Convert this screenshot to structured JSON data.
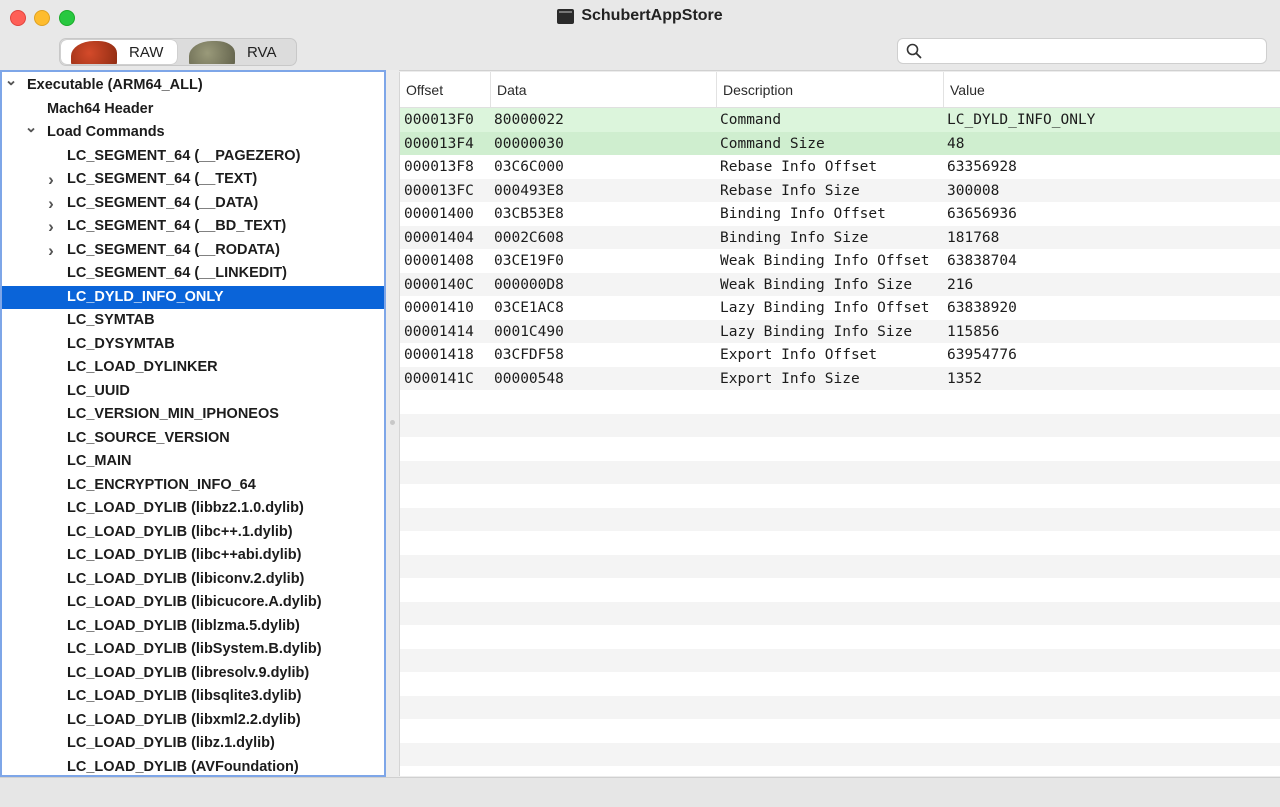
{
  "window": {
    "title": "SchubertAppStore"
  },
  "toolbar": {
    "segments": [
      {
        "label": "RAW",
        "selected": true,
        "icon": "ladybug-red-icon"
      },
      {
        "label": "RVA",
        "selected": false,
        "icon": "ladybug-gray-icon"
      }
    ],
    "search": {
      "placeholder": "",
      "value": ""
    }
  },
  "tree": {
    "items": [
      {
        "label": "Executable  (ARM64_ALL)",
        "level": 0,
        "chevron": "down"
      },
      {
        "label": "Mach64 Header",
        "level": 1,
        "chevron": ""
      },
      {
        "label": "Load Commands",
        "level": 1,
        "chevron": "down"
      },
      {
        "label": "LC_SEGMENT_64 (__PAGEZERO)",
        "level": 2,
        "chevron": ""
      },
      {
        "label": "LC_SEGMENT_64 (__TEXT)",
        "level": 2,
        "chevron": "right"
      },
      {
        "label": "LC_SEGMENT_64 (__DATA)",
        "level": 2,
        "chevron": "right"
      },
      {
        "label": "LC_SEGMENT_64 (__BD_TEXT)",
        "level": 2,
        "chevron": "right"
      },
      {
        "label": "LC_SEGMENT_64 (__RODATA)",
        "level": 2,
        "chevron": "right"
      },
      {
        "label": "LC_SEGMENT_64 (__LINKEDIT)",
        "level": 2,
        "chevron": ""
      },
      {
        "label": "LC_DYLD_INFO_ONLY",
        "level": 2,
        "chevron": "",
        "selected": true
      },
      {
        "label": "LC_SYMTAB",
        "level": 2,
        "chevron": ""
      },
      {
        "label": "LC_DYSYMTAB",
        "level": 2,
        "chevron": ""
      },
      {
        "label": "LC_LOAD_DYLINKER",
        "level": 2,
        "chevron": ""
      },
      {
        "label": "LC_UUID",
        "level": 2,
        "chevron": ""
      },
      {
        "label": "LC_VERSION_MIN_IPHONEOS",
        "level": 2,
        "chevron": ""
      },
      {
        "label": "LC_SOURCE_VERSION",
        "level": 2,
        "chevron": ""
      },
      {
        "label": "LC_MAIN",
        "level": 2,
        "chevron": ""
      },
      {
        "label": "LC_ENCRYPTION_INFO_64",
        "level": 2,
        "chevron": ""
      },
      {
        "label": "LC_LOAD_DYLIB (libbz2.1.0.dylib)",
        "level": 2,
        "chevron": ""
      },
      {
        "label": "LC_LOAD_DYLIB (libc++.1.dylib)",
        "level": 2,
        "chevron": ""
      },
      {
        "label": "LC_LOAD_DYLIB (libc++abi.dylib)",
        "level": 2,
        "chevron": ""
      },
      {
        "label": "LC_LOAD_DYLIB (libiconv.2.dylib)",
        "level": 2,
        "chevron": ""
      },
      {
        "label": "LC_LOAD_DYLIB (libicucore.A.dylib)",
        "level": 2,
        "chevron": ""
      },
      {
        "label": "LC_LOAD_DYLIB (liblzma.5.dylib)",
        "level": 2,
        "chevron": ""
      },
      {
        "label": "LC_LOAD_DYLIB (libSystem.B.dylib)",
        "level": 2,
        "chevron": ""
      },
      {
        "label": "LC_LOAD_DYLIB (libresolv.9.dylib)",
        "level": 2,
        "chevron": ""
      },
      {
        "label": "LC_LOAD_DYLIB (libsqlite3.dylib)",
        "level": 2,
        "chevron": ""
      },
      {
        "label": "LC_LOAD_DYLIB (libxml2.2.dylib)",
        "level": 2,
        "chevron": ""
      },
      {
        "label": "LC_LOAD_DYLIB (libz.1.dylib)",
        "level": 2,
        "chevron": ""
      },
      {
        "label": "LC_LOAD_DYLIB (AVFoundation)",
        "level": 2,
        "chevron": ""
      }
    ]
  },
  "table": {
    "columns": [
      "Offset",
      "Data",
      "Description",
      "Value"
    ],
    "rows": [
      {
        "offset": "000013F0",
        "data": "80000022",
        "description": "Command",
        "value": "LC_DYLD_INFO_ONLY",
        "highlight": true
      },
      {
        "offset": "000013F4",
        "data": "00000030",
        "description": "Command Size",
        "value": "48",
        "highlight": true
      },
      {
        "offset": "000013F8",
        "data": "03C6C000",
        "description": "Rebase Info Offset",
        "value": "63356928"
      },
      {
        "offset": "000013FC",
        "data": "000493E8",
        "description": "Rebase Info Size",
        "value": "300008"
      },
      {
        "offset": "00001400",
        "data": "03CB53E8",
        "description": "Binding Info Offset",
        "value": "63656936"
      },
      {
        "offset": "00001404",
        "data": "0002C608",
        "description": "Binding Info Size",
        "value": "181768"
      },
      {
        "offset": "00001408",
        "data": "03CE19F0",
        "description": "Weak Binding Info Offset",
        "value": "63838704"
      },
      {
        "offset": "0000140C",
        "data": "000000D8",
        "description": "Weak Binding Info Size",
        "value": "216"
      },
      {
        "offset": "00001410",
        "data": "03CE1AC8",
        "description": "Lazy Binding Info Offset",
        "value": "63838920"
      },
      {
        "offset": "00001414",
        "data": "0001C490",
        "description": "Lazy Binding Info Size",
        "value": "115856"
      },
      {
        "offset": "00001418",
        "data": "03CFDF58",
        "description": "Export Info Offset",
        "value": "63954776"
      },
      {
        "offset": "0000141C",
        "data": "00000548",
        "description": "Export Info Size",
        "value": "1352"
      }
    ]
  }
}
